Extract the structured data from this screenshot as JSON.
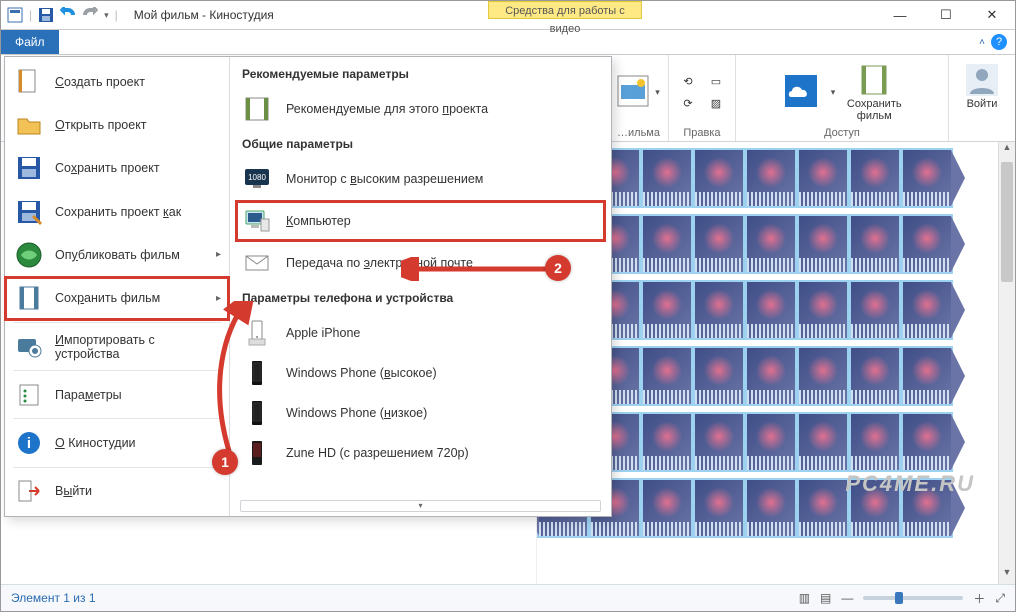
{
  "window": {
    "title": "Мой фильм - Киностудия",
    "video_tools_tab": "Средства для работы с видео"
  },
  "tabs": {
    "file": "Файл"
  },
  "ribbon": {
    "group_movie": "…ильма",
    "group_edit": "Правка",
    "group_access": "Доступ",
    "save_movie": "Сохранить\nфильм",
    "signin": "Войти"
  },
  "filemenu_left": [
    {
      "icon": "new",
      "label_pre": "",
      "u": "С",
      "label_post": "оздать проект"
    },
    {
      "icon": "open",
      "label_pre": "",
      "u": "О",
      "label_post": "ткрыть проект"
    },
    {
      "icon": "save",
      "label_pre": "Со",
      "u": "х",
      "label_post": "ранить проект"
    },
    {
      "icon": "saveas",
      "label_pre": "Сохранить проект ",
      "u": "к",
      "label_post": "ак"
    },
    {
      "icon": "publish",
      "label_pre": "Оп",
      "u": "у",
      "label_post": "бликовать фильм",
      "chev": true
    },
    {
      "icon": "savefilm",
      "label_pre": "Сох",
      "u": "р",
      "label_post": "анить фильм",
      "chev": true,
      "boxed": true
    },
    {
      "icon": "import",
      "label_pre": "",
      "u": "И",
      "label_post": "мпортировать с устройства"
    },
    {
      "icon": "options",
      "label_pre": "Пара",
      "u": "м",
      "label_post": "етры"
    },
    {
      "icon": "about",
      "label_pre": "",
      "u": "О",
      "label_post": " Киностудии"
    },
    {
      "icon": "exit",
      "label_pre": "В",
      "u": "ы",
      "label_post": "йти"
    }
  ],
  "filemenu_right": {
    "h1": "Рекомендуемые параметры",
    "rec": {
      "pre": "Рекомендуемые для этого ",
      "u": "п",
      "post": "роекта"
    },
    "h2": "Общие параметры",
    "hd": {
      "pre": "Монитор с ",
      "u": "в",
      "post": "ысоким разрешением"
    },
    "pc": {
      "pre": "",
      "u": "К",
      "post": "омпьютер",
      "boxed": true
    },
    "mail": {
      "pre": "Передача по ",
      "u": "э",
      "post": "лектронной почте"
    },
    "h3": "Параметры телефона и устройства",
    "iphone": "Apple iPhone",
    "wp_hi": {
      "pre": "Windows Phone (",
      "u": "в",
      "post": "ысокое)"
    },
    "wp_lo": {
      "pre": "Windows Phone (",
      "u": "н",
      "post": "изкое)"
    },
    "zune": "Zune HD (с разрешением 720p)"
  },
  "annotations": {
    "badge1": "1",
    "badge2": "2"
  },
  "status": {
    "left": "Элемент 1 из 1"
  },
  "watermark": "PC4ME.RU"
}
